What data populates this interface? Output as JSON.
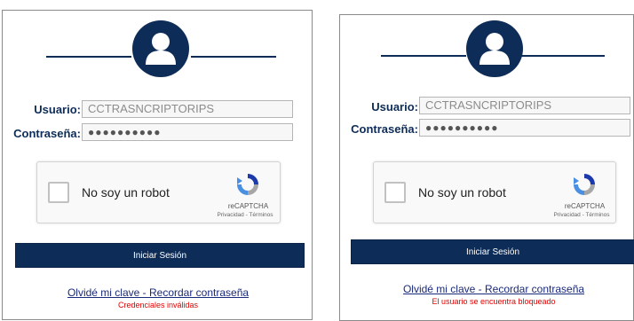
{
  "colors": {
    "brand_navy": "#0d2c57",
    "error_red": "#e00000",
    "link_blue": "#1a2a7a"
  },
  "icons": {
    "avatar": "user-icon",
    "captcha": "recaptcha-logo-icon"
  },
  "panels": [
    {
      "form": {
        "username_label": "Usuario:",
        "username_value": "CCTRASNCRIPTORIPS",
        "password_label": "Contraseña:",
        "password_value": "●●●●●●●●●●"
      },
      "captcha": {
        "label": "No soy un robot",
        "brand": "reCAPTCHA",
        "terms": "Privacidad - Términos"
      },
      "login_label": "Iniciar Sesión",
      "forgot_label": "Olvidé mi clave - Recordar contraseña",
      "error_message": "Credenciales inválidas"
    },
    {
      "form": {
        "username_label": "Usuario:",
        "username_value": "CCTRASNCRIPTORIPS",
        "password_label": "Contraseña:",
        "password_value": "●●●●●●●●●●"
      },
      "captcha": {
        "label": "No soy un robot",
        "brand": "reCAPTCHA",
        "terms": "Privacidad - Términos"
      },
      "login_label": "Iniciar Sesión",
      "forgot_label": "Olvidé mi clave - Recordar contraseña",
      "error_message": "El usuario se encuentra bloqueado"
    }
  ]
}
